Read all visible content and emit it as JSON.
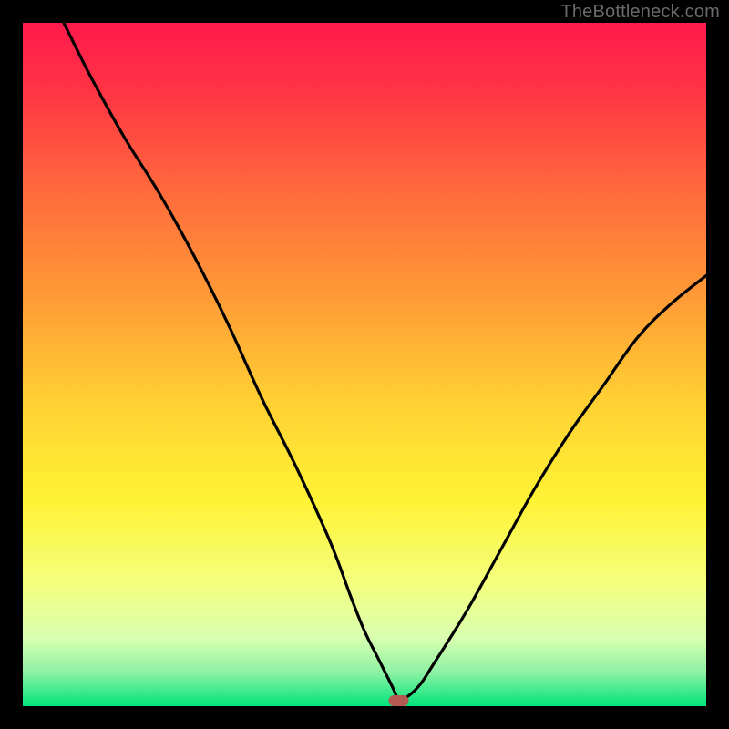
{
  "watermark": "TheBottleneck.com",
  "colors": {
    "background": "#000000",
    "curve": "#000000",
    "marker_fill": "#b55a52",
    "gradient_stops": [
      {
        "offset": 0.0,
        "color": "#ff1a4b"
      },
      {
        "offset": 0.1,
        "color": "#ff3445"
      },
      {
        "offset": 0.25,
        "color": "#ff6b3c"
      },
      {
        "offset": 0.4,
        "color": "#ff9a36"
      },
      {
        "offset": 0.55,
        "color": "#ffcf33"
      },
      {
        "offset": 0.7,
        "color": "#fff335"
      },
      {
        "offset": 0.82,
        "color": "#f4ff7e"
      },
      {
        "offset": 0.9,
        "color": "#d9ffb0"
      },
      {
        "offset": 0.95,
        "color": "#8ef2a4"
      },
      {
        "offset": 1.0,
        "color": "#00e47a"
      }
    ]
  },
  "chart_data": {
    "type": "line",
    "title": "",
    "xlabel": "",
    "ylabel": "",
    "xlim": [
      0,
      100
    ],
    "ylim": [
      0,
      100
    ],
    "marker": {
      "x": 55,
      "y": 0.8
    },
    "series": [
      {
        "name": "curve",
        "x": [
          6,
          10,
          15,
          20,
          25,
          30,
          35,
          40,
          45,
          48,
          50,
          52,
          54,
          55,
          56,
          58,
          60,
          65,
          70,
          75,
          80,
          85,
          90,
          95,
          100
        ],
        "y": [
          100,
          92,
          83,
          75,
          66,
          56,
          45,
          35,
          24,
          16,
          11,
          7,
          3,
          1,
          1.2,
          3,
          6,
          14,
          23,
          32,
          40,
          47,
          54,
          59,
          63
        ]
      }
    ]
  }
}
